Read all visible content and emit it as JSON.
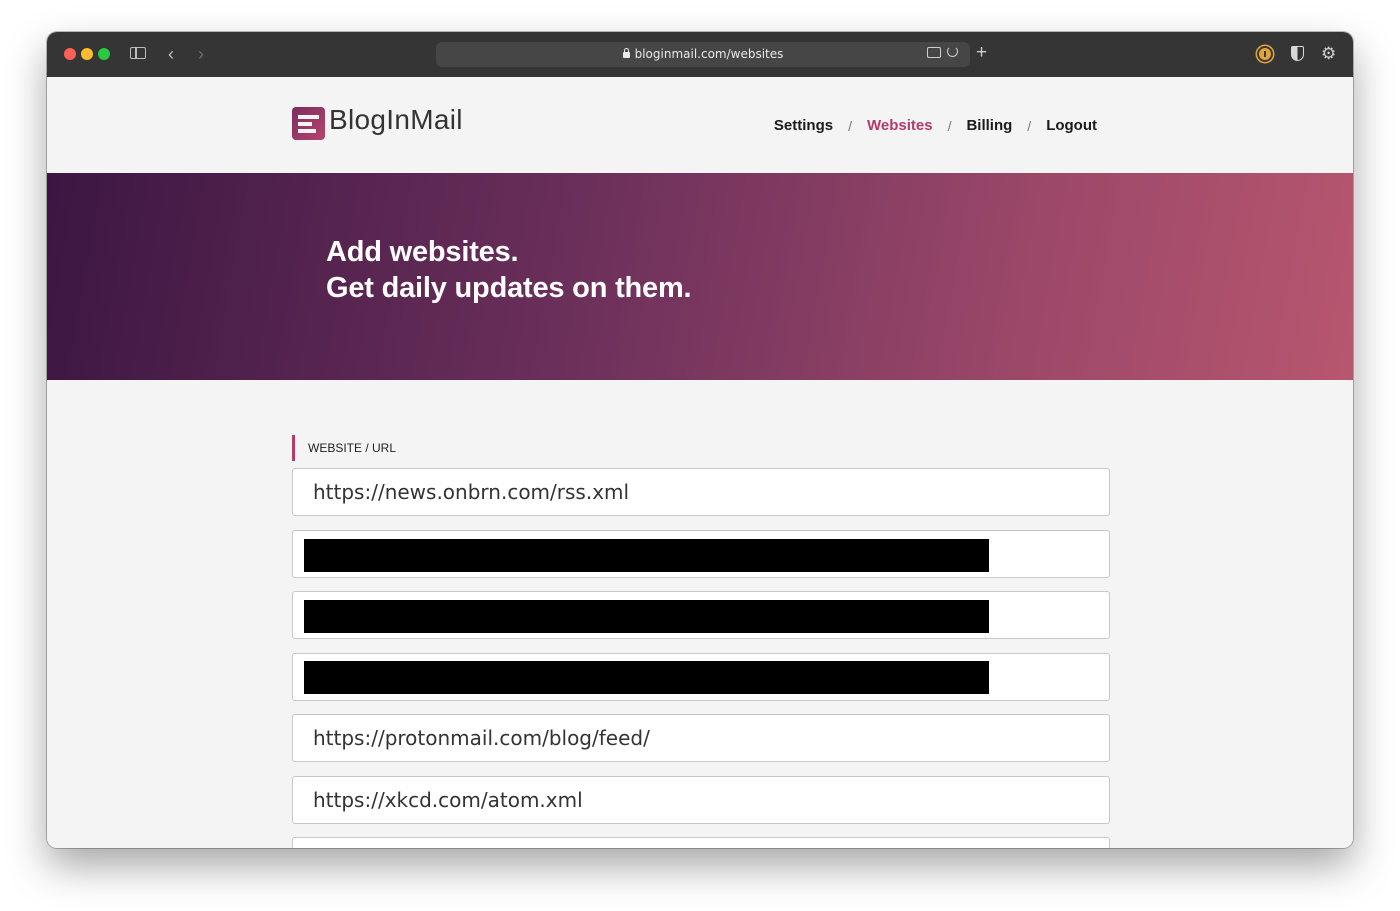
{
  "browser": {
    "url": "bloginmail.com/websites",
    "icons": [
      "close-window-icon",
      "minimize-window-icon",
      "zoom-window-icon",
      "sidebar-icon",
      "back-icon",
      "forward-icon",
      "lock-icon",
      "translate-icon",
      "reload-icon",
      "new-tab-icon",
      "password-manager-icon",
      "privacy-shield-icon",
      "settings-gear-icon"
    ]
  },
  "brand": {
    "name": "BlogInMail",
    "accent": "#b43b6a"
  },
  "nav": {
    "items": [
      {
        "label": "Settings",
        "active": false
      },
      {
        "label": "Websites",
        "active": true
      },
      {
        "label": "Billing",
        "active": false
      },
      {
        "label": "Logout",
        "active": false
      }
    ],
    "separator": "/"
  },
  "hero": {
    "line1": "Add websites.",
    "line2": "Get daily updates on them."
  },
  "form": {
    "label": "WEBSITE / URL",
    "inputs": [
      {
        "value": "https://news.onbrn.com/rss.xml",
        "redacted": false
      },
      {
        "value": "",
        "redacted": true
      },
      {
        "value": "",
        "redacted": true
      },
      {
        "value": "",
        "redacted": true
      },
      {
        "value": "https://protonmail.com/blog/feed/",
        "redacted": false
      },
      {
        "value": "https://xkcd.com/atom.xml",
        "redacted": false
      },
      {
        "value": "",
        "redacted": false
      }
    ]
  }
}
